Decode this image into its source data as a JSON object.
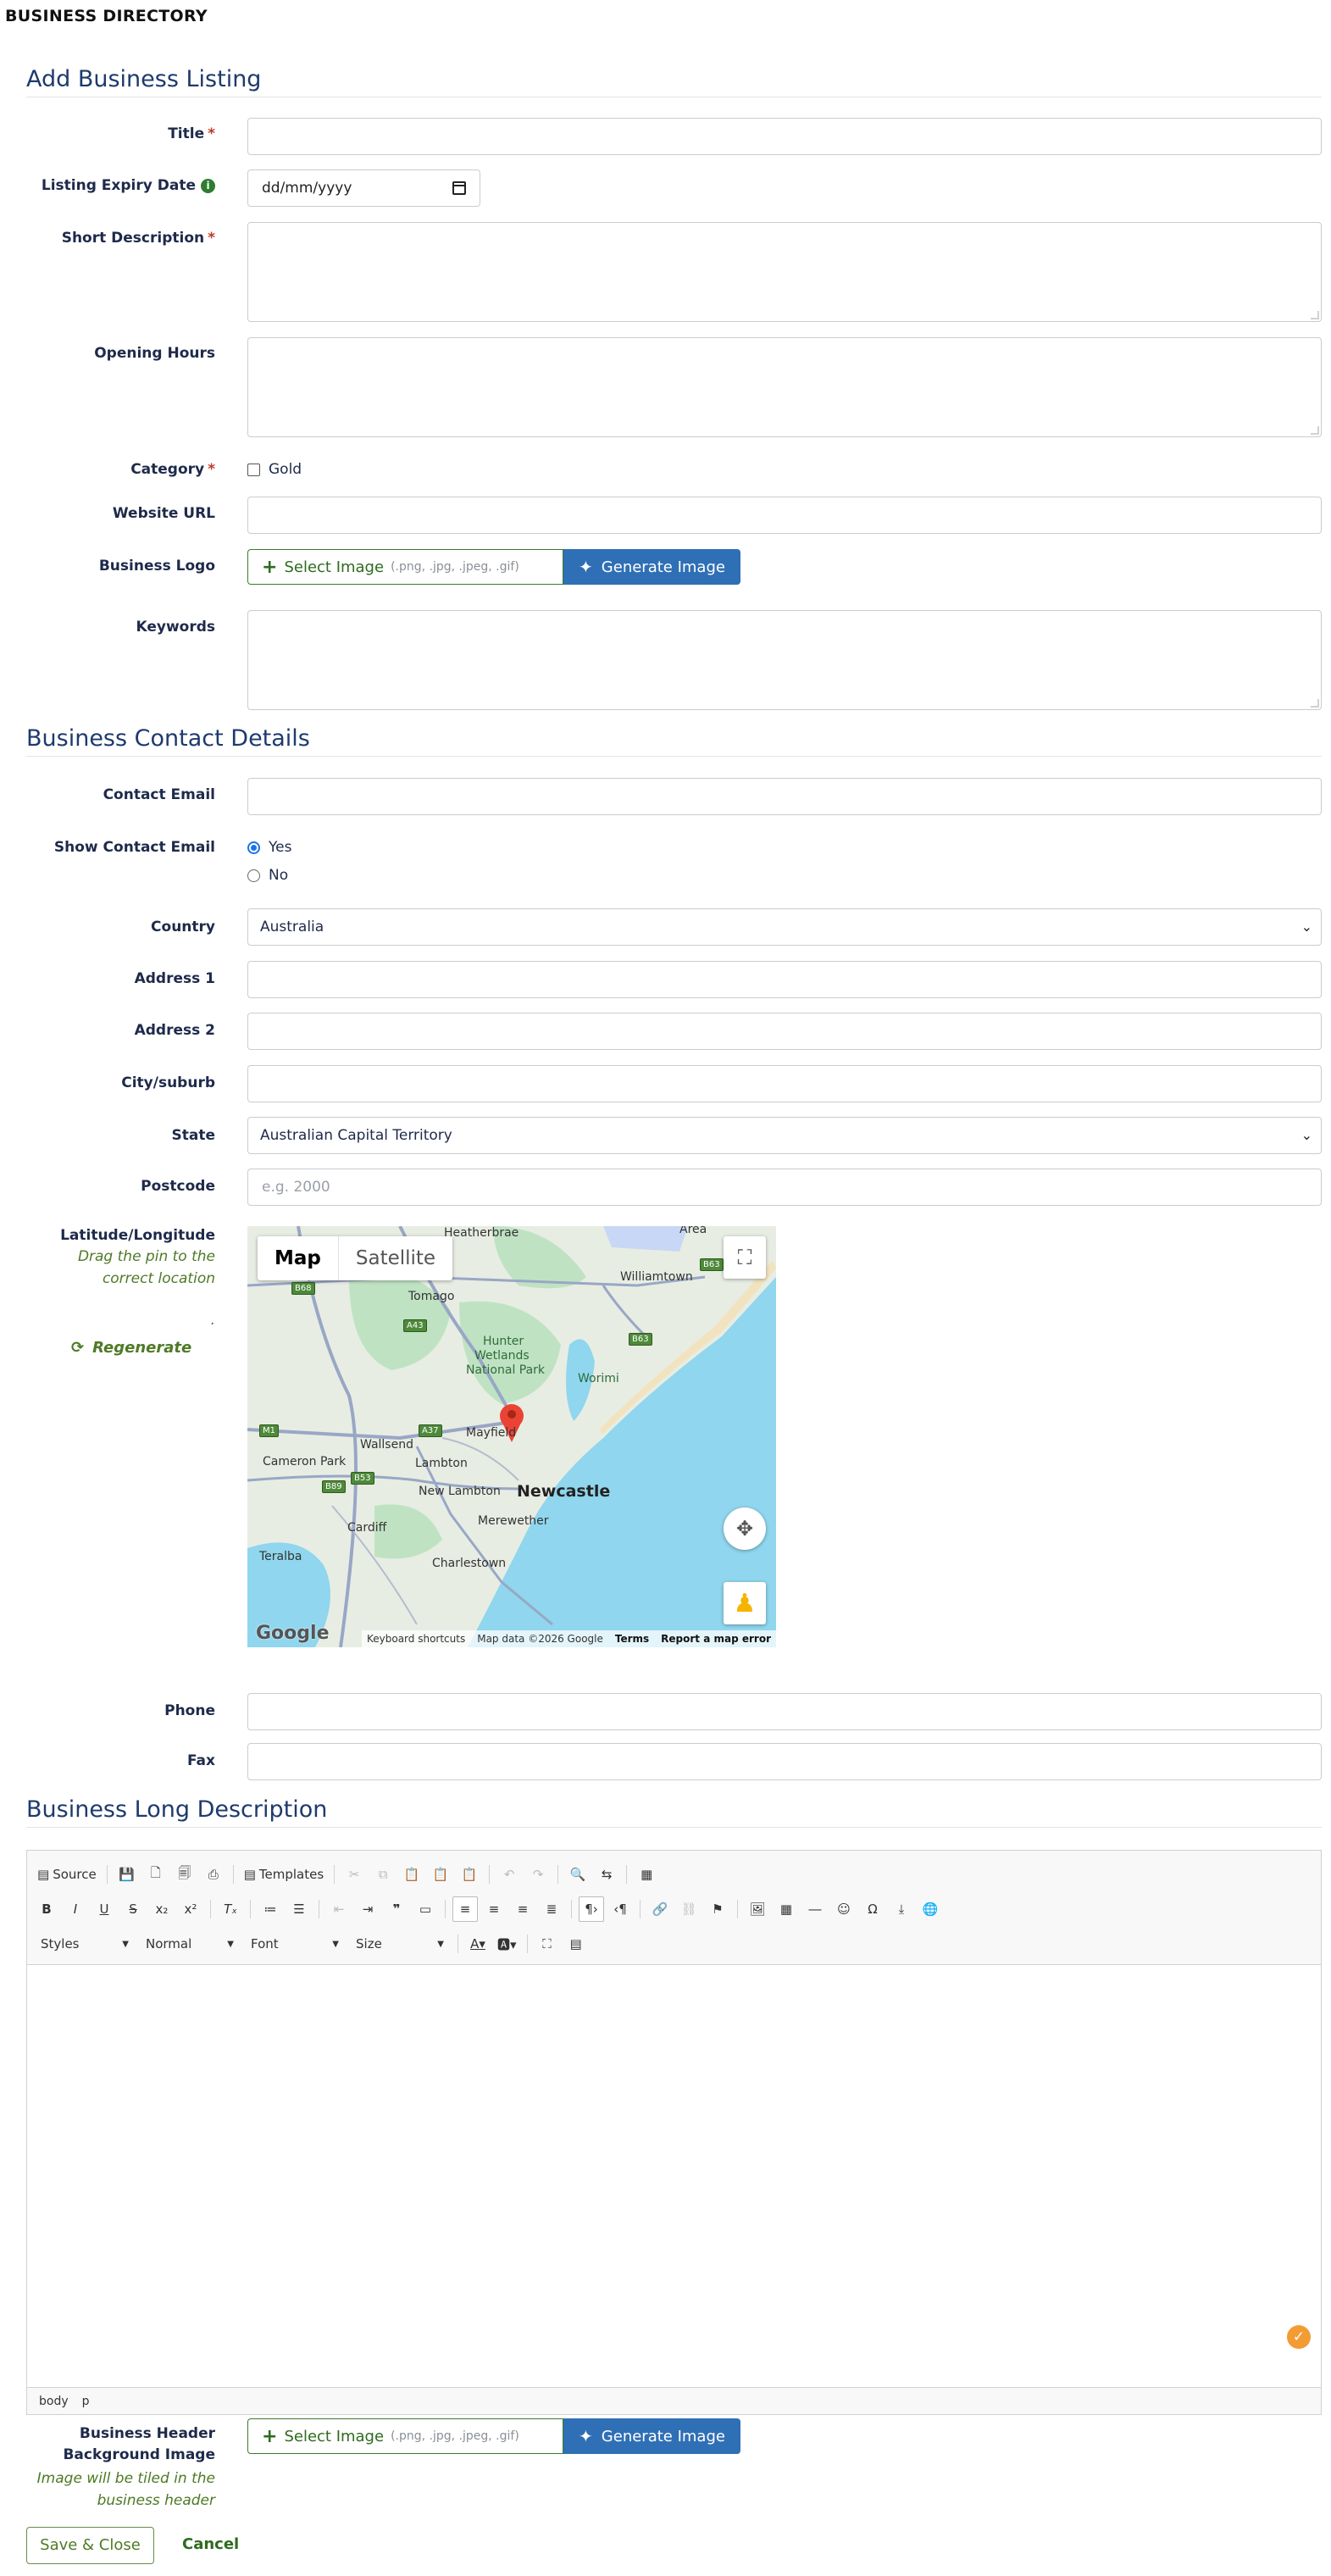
{
  "app": {
    "title": "BUSINESS DIRECTORY"
  },
  "sections": {
    "listing": "Add Business Listing",
    "contact": "Business Contact Details",
    "long_desc": "Business Long Description"
  },
  "form": {
    "title_label": "Title",
    "expiry_label": "Listing Expiry Date",
    "expiry_placeholder": "dd/mm/yyyy",
    "short_desc_label": "Short Description",
    "opening_hours_label": "Opening Hours",
    "category_label": "Category",
    "category_option": "Gold",
    "website_label": "Website URL",
    "logo_label": "Business Logo",
    "select_image": "Select Image",
    "image_types": "(.png, .jpg, .jpeg, .gif)",
    "generate_image": "Generate Image",
    "keywords_label": "Keywords",
    "contact_email_label": "Contact Email",
    "show_contact_label": "Show Contact Email",
    "yes": "Yes",
    "no": "No",
    "country_label": "Country",
    "country_value": "Australia",
    "address1_label": "Address 1",
    "address2_label": "Address 2",
    "city_label": "City/suburb",
    "state_label": "State",
    "state_value": "Australian Capital Territory",
    "postcode_label": "Postcode",
    "postcode_placeholder": "e.g. 2000",
    "latlng_label": "Latitude/Longitude",
    "latlng_hint": "Drag the pin to the correct location",
    "latlng_dot": ".",
    "regenerate": "Regenerate",
    "phone_label": "Phone",
    "fax_label": "Fax",
    "header_bg_label": "Business Header Background Image",
    "header_bg_hint": "Image will be tiled in the business header"
  },
  "map": {
    "tab_map": "Map",
    "tab_satellite": "Satellite",
    "google": "Google",
    "shortcuts": "Keyboard shortcuts",
    "map_data": "Map data ©2026 Google",
    "terms": "Terms",
    "report": "Report a map error",
    "places": {
      "heatherbrae": "Heatherbrae",
      "williamtown": "Williamtown",
      "tomago": "Tomago",
      "hunter1": "Hunter",
      "hunter2": "Wetlands",
      "hunter3": "National Park",
      "worimi": "Worimi",
      "mayfield": "Mayfield",
      "wallsend": "Wallsend",
      "cameron_park": "Cameron Park",
      "lambton": "Lambton",
      "new_lambton": "New Lambton",
      "newcastle": "Newcastle",
      "merewether": "Merewether",
      "cardiff": "Cardiff",
      "charlestown": "Charlestown",
      "teralba": "Teralba",
      "area": "Area"
    },
    "shields": {
      "b68": "B68",
      "a43": "A43",
      "b63a": "B63",
      "b63b": "B63",
      "m1": "M1",
      "a37": "A37",
      "b89": "B89",
      "b53": "B53"
    }
  },
  "editor": {
    "source": "Source",
    "templates": "Templates",
    "styles": "Styles",
    "format": "Normal",
    "font": "Font",
    "size": "Size",
    "path_body": "body",
    "path_p": "p"
  },
  "actions": {
    "save_close": "Save & Close",
    "cancel": "Cancel"
  }
}
